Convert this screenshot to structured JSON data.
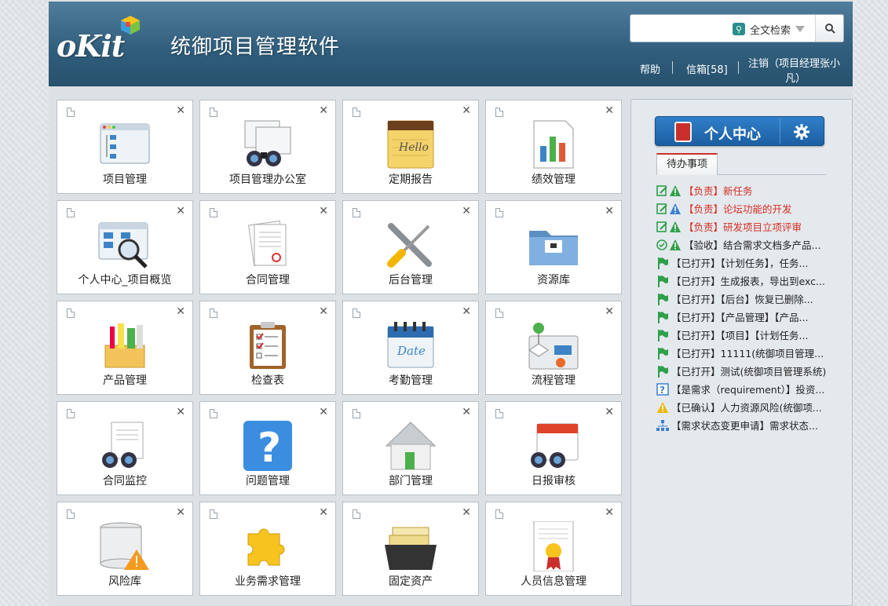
{
  "header": {
    "logo_text": "oKit",
    "app_title": "统御项目管理软件",
    "search": {
      "placeholder": "",
      "mode_label": "全文检索"
    },
    "links": {
      "help": "帮助",
      "mailbox": "信箱[58]",
      "logout_line1": "注销（项目经理张小",
      "logout_line2": "凡）"
    }
  },
  "tiles": [
    {
      "label": "项目管理",
      "icon": "window-list-icon"
    },
    {
      "label": "项目管理办公室",
      "icon": "binoculars-windows-icon"
    },
    {
      "label": "定期报告",
      "icon": "notepad-hello-icon"
    },
    {
      "label": "绩效管理",
      "icon": "bar-chart-doc-icon"
    },
    {
      "label": "个人中心_项目概览",
      "icon": "magnifier-window-icon"
    },
    {
      "label": "合同管理",
      "icon": "contract-papers-icon"
    },
    {
      "label": "后台管理",
      "icon": "wrench-screwdriver-icon"
    },
    {
      "label": "资源库",
      "icon": "folder-icon"
    },
    {
      "label": "产品管理",
      "icon": "product-box-icon"
    },
    {
      "label": "检查表",
      "icon": "clipboard-checklist-icon"
    },
    {
      "label": "考勤管理",
      "icon": "calendar-date-icon"
    },
    {
      "label": "流程管理",
      "icon": "flowchart-icon"
    },
    {
      "label": "合同监控",
      "icon": "binoculars-papers-icon"
    },
    {
      "label": "问题管理",
      "icon": "question-icon"
    },
    {
      "label": "部门管理",
      "icon": "house-icon"
    },
    {
      "label": "日报审核",
      "icon": "binoculars-calendar-icon"
    },
    {
      "label": "风险库",
      "icon": "database-warning-icon"
    },
    {
      "label": "业务需求管理",
      "icon": "puzzle-icon"
    },
    {
      "label": "固定资产",
      "icon": "card-box-icon"
    },
    {
      "label": "人员信息管理",
      "icon": "certificate-icon"
    }
  ],
  "right_panel": {
    "personal_center_label": "个人中心",
    "tab_label": "待办事项",
    "todos": [
      {
        "text": "【负责】新任务",
        "icon": "edit-warning-icon",
        "red": true
      },
      {
        "text": "【负责】论坛功能的开发",
        "icon": "edit-info-icon",
        "red": true
      },
      {
        "text": "【负责】研发项目立项评审",
        "icon": "edit-warning-icon",
        "red": true
      },
      {
        "text": "【验收】结合需求文档多产品...",
        "icon": "check-warning-icon",
        "red": false
      },
      {
        "text": "【已打开】【计划任务】，任务...",
        "icon": "flag-icon",
        "red": false
      },
      {
        "text": "【已打开】生成报表，导出到exc...",
        "icon": "flag-icon",
        "red": false
      },
      {
        "text": "【已打开】【后台】恢复已删除...",
        "icon": "flag-icon",
        "red": false
      },
      {
        "text": "【已打开】【产品管理】【产品...",
        "icon": "flag-icon",
        "red": false
      },
      {
        "text": "【已打开】【项目】【计划任务...",
        "icon": "flag-icon",
        "red": false
      },
      {
        "text": "【已打开】11111(统御项目管理...",
        "icon": "flag-icon",
        "red": false
      },
      {
        "text": "【已打开】测试(统御项目管理系统)",
        "icon": "flag-icon",
        "red": false
      },
      {
        "text": "【是需求（requirement）】投资...",
        "icon": "question-box-icon",
        "red": false
      },
      {
        "text": "【已确认】人力资源风险(统御项...",
        "icon": "warning-icon",
        "red": false
      },
      {
        "text": "【需求状态变更申请】需求状态...",
        "icon": "org-chart-icon",
        "red": false
      }
    ]
  },
  "colors": {
    "header_top": "#4f7d9b",
    "header_bottom": "#28526e",
    "accent_red": "#d62d20",
    "button_blue": "#2f7fc9"
  }
}
